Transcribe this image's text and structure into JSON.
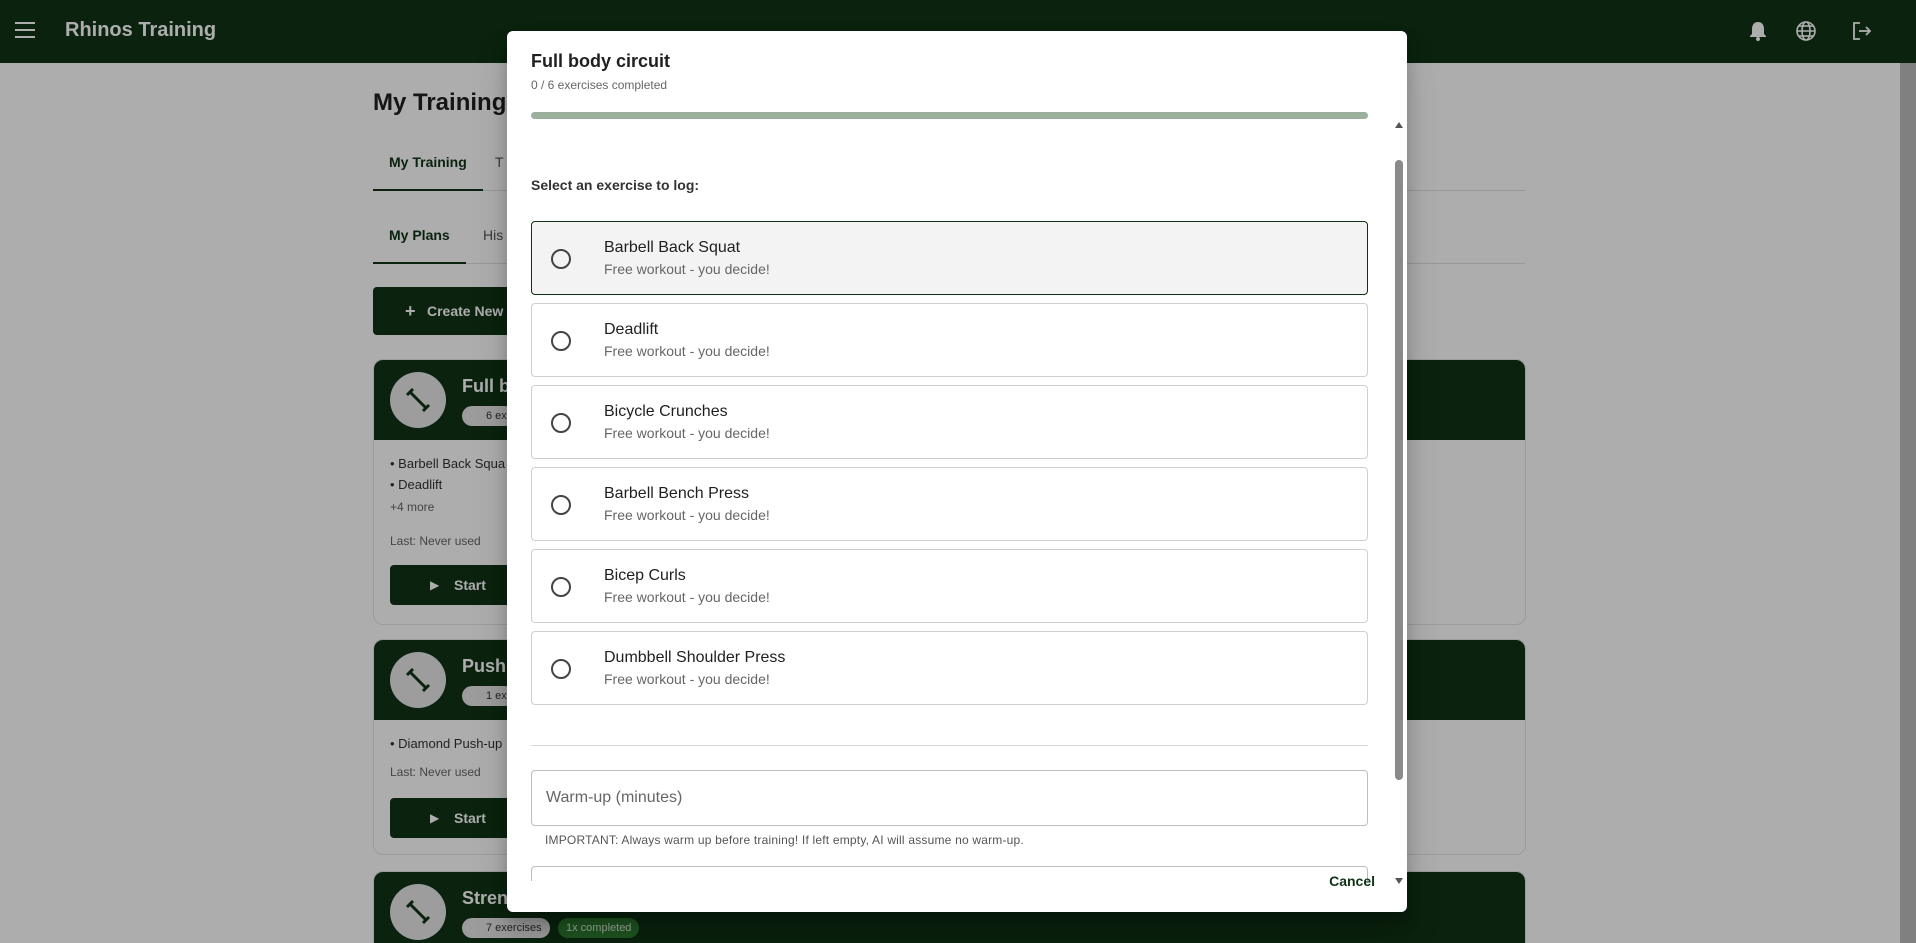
{
  "app": {
    "title": "Rhinos Training"
  },
  "page": {
    "title": "My Training",
    "tabs1": [
      "My Training",
      "T"
    ],
    "tabs2": [
      "My Plans",
      "His"
    ],
    "create_label": "Create New"
  },
  "plans": [
    {
      "name": "Full b",
      "chip": "6 ex",
      "items": [
        "• Barbell Back Squa",
        "• Deadlift"
      ],
      "more": "+4 more",
      "last": "Last: Never used",
      "start": "Start"
    },
    {
      "name": "Pushu",
      "chip": "1 ex",
      "items": [
        "• Diamond Push-up"
      ],
      "last": "Last: Never used",
      "start": "Start"
    },
    {
      "name": "Streng",
      "chip": "7 exercises",
      "chip2": "1x completed"
    }
  ],
  "dialog": {
    "title": "Full body circuit",
    "subtitle": "0 / 6 exercises completed",
    "progress": 0,
    "prompt": "Select an exercise to log:",
    "exercises": [
      {
        "name": "Barbell Back Squat",
        "desc": "Free workout - you decide!"
      },
      {
        "name": "Deadlift",
        "desc": "Free workout - you decide!"
      },
      {
        "name": "Bicycle Crunches",
        "desc": "Free workout - you decide!"
      },
      {
        "name": "Barbell Bench Press",
        "desc": "Free workout - you decide!"
      },
      {
        "name": "Bicep Curls",
        "desc": "Free workout - you decide!"
      },
      {
        "name": "Dumbbell Shoulder Press",
        "desc": "Free workout - you decide!"
      }
    ],
    "warmup_placeholder": "Warm-up (minutes)",
    "warmup_hint": "IMPORTANT: Always warm up before training! If left empty, AI will assume no warm-up.",
    "cancel_label": "Cancel"
  },
  "icons": {
    "menu": "menu-icon",
    "bell": "bell-icon",
    "globe": "globe-icon",
    "logout": "logout-icon"
  },
  "colors": {
    "primary": "#0f3316",
    "progress_track": "#9bb09c"
  }
}
